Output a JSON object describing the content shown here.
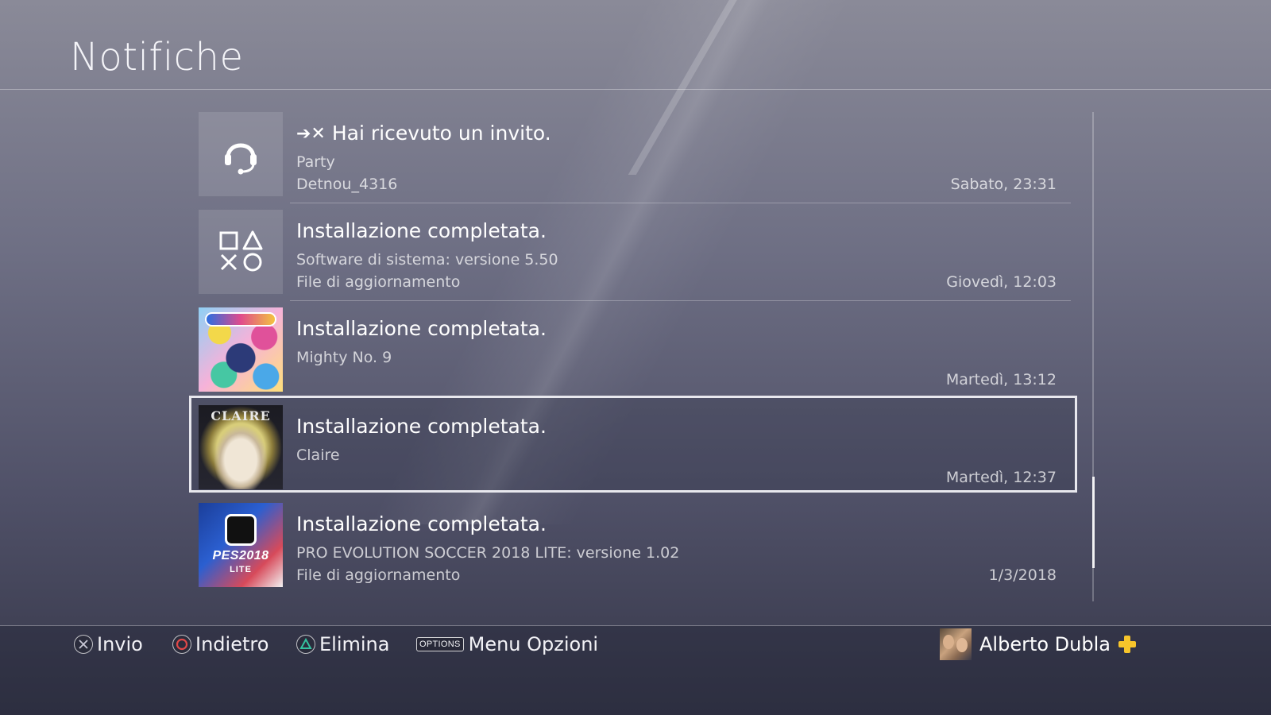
{
  "header": {
    "title": "Notifiche"
  },
  "notifications": [
    {
      "prefix": "➔✕",
      "headline": "Hai ricevuto un invito.",
      "line1": "Party",
      "line2": "Detnou_4316",
      "time": "Sabato, 23:31",
      "icon": "headset-icon"
    },
    {
      "headline": "Installazione completata.",
      "line1": "Software di sistema: versione 5.50",
      "line2": "File di aggiornamento",
      "time": "Giovedì, 12:03",
      "icon": "playstation-shapes-icon"
    },
    {
      "headline": "Installazione completata.",
      "line1": "Mighty No. 9",
      "line2": "",
      "time": "Martedì, 13:12",
      "icon": "mighty-no-9-cover"
    },
    {
      "headline": "Installazione completata.",
      "line1": "Claire",
      "line2": "",
      "time": "Martedì, 12:37",
      "icon": "claire-cover",
      "cover_text": "CLAIRE",
      "selected": true
    },
    {
      "headline": "Installazione completata.",
      "line1": "PRO EVOLUTION SOCCER 2018 LITE: versione 1.02",
      "line2": "File di aggiornamento",
      "time": "1/3/2018",
      "icon": "pes-2018-cover",
      "cover_title": "PES2018",
      "cover_sub": "LITE"
    }
  ],
  "footer": {
    "hints": [
      {
        "button": "cross-button-icon",
        "label": "Invio",
        "color": "#c8c8d6"
      },
      {
        "button": "circle-button-icon",
        "label": "Indietro",
        "color": "#e04848"
      },
      {
        "button": "triangle-button-icon",
        "label": "Elimina",
        "color": "#35c2a0"
      },
      {
        "button": "options-button-icon",
        "badge": "OPTIONS",
        "label": "Menu Opzioni"
      }
    ],
    "user": {
      "name": "Alberto Dubla",
      "plus_color": "#f7c52b"
    }
  }
}
